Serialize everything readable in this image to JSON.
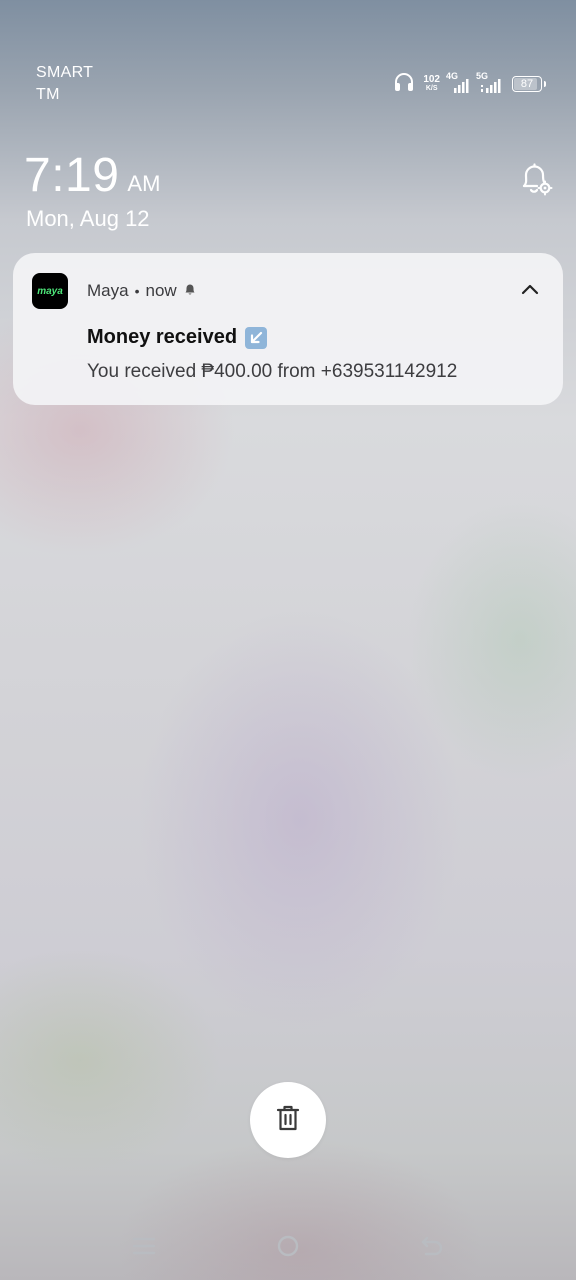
{
  "status_bar": {
    "carrier_line1": "SMART",
    "carrier_line2": "TM",
    "speed_value": "102",
    "speed_unit": "K/S",
    "network_1": "4G",
    "network_2": "5G",
    "battery": "87",
    "battery_level": 0.87,
    "icons": [
      "headphones-icon",
      "signal-icon",
      "battery-icon"
    ]
  },
  "lock": {
    "time": "7:19",
    "ampm": "AM",
    "date": "Mon, Aug 12"
  },
  "notification": {
    "app_name": "Maya",
    "app_icon_text": "maya",
    "separator": "•",
    "time": "now",
    "title": "Money received",
    "title_emoji": "↙",
    "body": "You received ₱400.00 from +639531142912",
    "icon_color": "#4ee87a"
  },
  "colors": {
    "card_bg": "#f3f3f5",
    "app_icon_bg": "#000000",
    "emoji_bg": "#8fb5d9"
  }
}
